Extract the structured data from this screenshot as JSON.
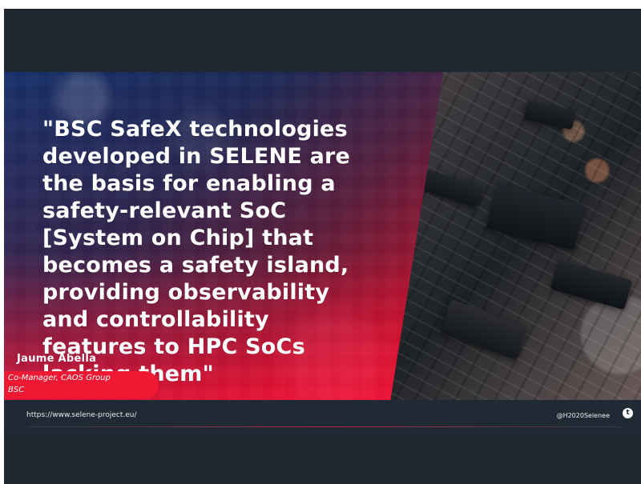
{
  "slide": {
    "quote": "\"BSC SafeX technologies developed in SELENE are the basis for enabling a safety-relevant SoC [System on Chip] that becomes a safety island, providing observability and controllability features to HPC SoCs lacking them\"",
    "speaker_name": "Jaume  Abella",
    "speaker_role_line1": "Co-Manager, CAOS Group",
    "speaker_role_line2": "BSC"
  },
  "footer": {
    "website": "https://www.selene-project.eu/",
    "handle": "@H2020Selenee"
  },
  "icons": {
    "social": "twitter-icon"
  },
  "colors": {
    "dark_background": "#1f2731",
    "accent_red": "#f01832",
    "blue_tint": "#18336e"
  }
}
